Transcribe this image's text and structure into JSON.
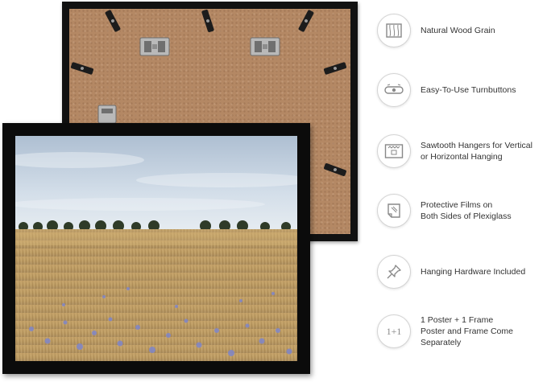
{
  "features": [
    {
      "icon": "wood-grain-icon",
      "lines": [
        "Natural Wood Grain"
      ]
    },
    {
      "icon": "turnbutton-icon",
      "lines": [
        "Easy-To-Use Turnbuttons"
      ]
    },
    {
      "icon": "sawtooth-hanger-icon",
      "lines": [
        "Sawtooth Hangers for Vertical",
        "or Horizontal Hanging"
      ]
    },
    {
      "icon": "protective-film-icon",
      "lines": [
        "Protective Films on",
        "Both Sides of Plexiglass"
      ]
    },
    {
      "icon": "pushpin-icon",
      "lines": [
        "Hanging Hardware Included"
      ]
    },
    {
      "icon": "one-plus-one-icon",
      "icon_text": "1+1",
      "lines": [
        "1 Poster + 1 Frame",
        "Poster and Frame Come Separately"
      ]
    }
  ],
  "colors": {
    "frame": "#0b0b0b",
    "backing": "#b48864",
    "sky": "#c9d9e8",
    "wheat": "#bf9d62",
    "cornflower": "#7f86c9"
  }
}
